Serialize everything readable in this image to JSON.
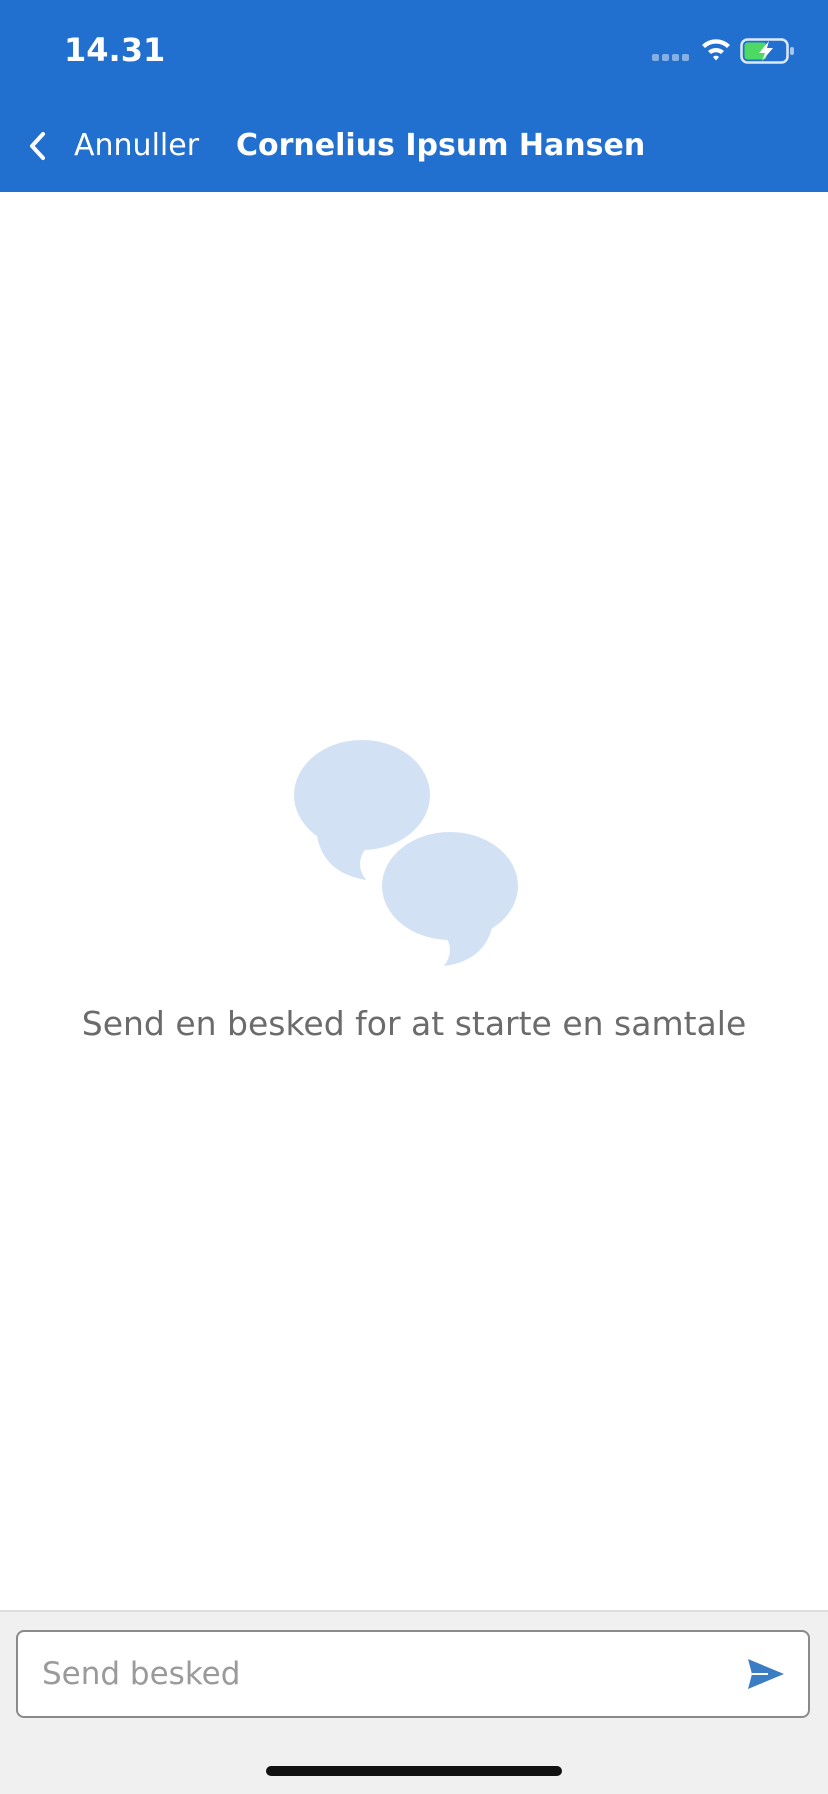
{
  "status_bar": {
    "time": "14.31",
    "signal_icon": "cellular-signal-icon",
    "wifi_icon": "wifi-icon",
    "battery_icon": "battery-charging-icon"
  },
  "nav": {
    "back_icon": "chevron-left-icon",
    "back_label": "Annuller",
    "title": "Cornelius Ipsum Hansen"
  },
  "empty_state": {
    "icon": "chat-bubbles-icon",
    "message": "Send en besked for at starte en samtale"
  },
  "composer": {
    "placeholder": "Send besked",
    "value": "",
    "send_icon": "send-icon"
  },
  "colors": {
    "header": "#216FCE",
    "illustration": "#D3E1F5",
    "send": "#3B7DC4",
    "battery_fill": "#4CD964",
    "composer_bg": "#F0F0F0"
  }
}
